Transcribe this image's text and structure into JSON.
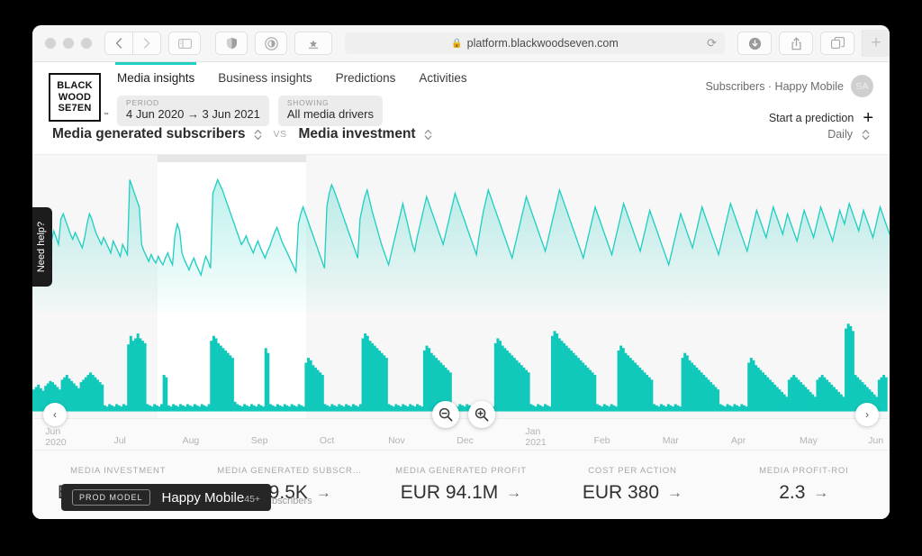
{
  "browser": {
    "url": "platform.blackwoodseven.com",
    "lock_icon": "lock-icon",
    "reload_icon": "reload-icon",
    "back_icon": "chevron-left-icon",
    "forward_icon": "chevron-right-icon",
    "sidebar_icon": "sidebar-icon",
    "shield_icon": "shield-icon",
    "reader_icon": "reader-icon",
    "bookmark_icon": "bookmark-star-icon",
    "download_icon": "download-icon",
    "share_icon": "share-icon",
    "tabs_icon": "tab-overview-icon",
    "newtab_label": "+"
  },
  "header": {
    "logo_lines": [
      "BLACK",
      "WOOD",
      "SE7EN"
    ],
    "logo_tm": "™",
    "tabs": [
      {
        "label": "Media insights",
        "active": true
      },
      {
        "label": "Business insights",
        "active": false
      },
      {
        "label": "Predictions",
        "active": false
      },
      {
        "label": "Activities",
        "active": false
      }
    ],
    "pills": [
      {
        "caption": "PERIOD",
        "value": "4 Jun 2020 → 3 Jun 2021"
      },
      {
        "caption": "SHOWING",
        "value": "All media drivers"
      }
    ],
    "account": "Subscribers · Happy Mobile",
    "avatar_initials": "SA",
    "start_prediction": "Start a prediction",
    "start_prediction_plus": "+"
  },
  "selector": {
    "primary_metric": "Media generated subscribers",
    "vs": "VS",
    "secondary_metric": "Media investment",
    "granularity": "Daily"
  },
  "chart": {
    "need_help": "Need help?",
    "prev_label": "‹",
    "next_label": "›",
    "zoom_out_icon": "zoom-out-icon",
    "zoom_in_icon": "zoom-in-icon",
    "line_color": "#21cfc2",
    "bar_color": "#11c9bb",
    "background": "#f7f7f7",
    "selection_background": "#ffffff"
  },
  "chart_data": {
    "type": "area",
    "title": "Media generated subscribers vs Media investment",
    "xlabel": "",
    "ylabel": "",
    "grid": false,
    "legend": "none",
    "x_tick_labels": [
      "Jun\n2020",
      "Jul",
      "Aug",
      "Sep",
      "Oct",
      "Nov",
      "Dec",
      "Jan\n2021",
      "Feb",
      "Mar",
      "Apr",
      "May",
      "Jun"
    ],
    "selection_range": [
      "Aug",
      "Sep"
    ],
    "series": [
      {
        "name": "Media generated subscribers",
        "type": "area",
        "color": "#21cfc2",
        "values": [
          41,
          38,
          44,
          40,
          46,
          43,
          39,
          45,
          42,
          48,
          44,
          40,
          55,
          58,
          54,
          50,
          46,
          43,
          47,
          44,
          41,
          38,
          44,
          52,
          58,
          55,
          50,
          46,
          43,
          40,
          44,
          41,
          38,
          35,
          42,
          39,
          36,
          33,
          40,
          37,
          34,
          78,
          74,
          70,
          66,
          62,
          40,
          36,
          33,
          30,
          34,
          31,
          29,
          33,
          30,
          28,
          32,
          35,
          31,
          28,
          45,
          52,
          48,
          35,
          31,
          28,
          25,
          29,
          32,
          28,
          25,
          22,
          28,
          33,
          30,
          26,
          70,
          74,
          78,
          75,
          72,
          68,
          64,
          60,
          56,
          52,
          48,
          44,
          40,
          42,
          45,
          41,
          38,
          35,
          39,
          42,
          38,
          35,
          32,
          36,
          39,
          43,
          47,
          50,
          46,
          42,
          39,
          36,
          33,
          30,
          27,
          24,
          52,
          58,
          62,
          58,
          54,
          50,
          46,
          42,
          38,
          34,
          30,
          26,
          62,
          70,
          75,
          72,
          68,
          64,
          60,
          56,
          52,
          48,
          44,
          40,
          36,
          32,
          55,
          62,
          68,
          72,
          66,
          60,
          55,
          50,
          45,
          40,
          36,
          32,
          28,
          34,
          40,
          46,
          52,
          58,
          64,
          58,
          52,
          46,
          40,
          36,
          44,
          50,
          56,
          62,
          68,
          64,
          60,
          56,
          52,
          48,
          44,
          40,
          46,
          52,
          58,
          64,
          70,
          66,
          62,
          58,
          54,
          50,
          46,
          42,
          38,
          34,
          44,
          52,
          60,
          66,
          72,
          68,
          64,
          60,
          56,
          52,
          48,
          44,
          40,
          36,
          32,
          38,
          44,
          50,
          56,
          62,
          68,
          64,
          60,
          56,
          52,
          48,
          44,
          40,
          36,
          42,
          48,
          54,
          60,
          66,
          72,
          68,
          64,
          60,
          56,
          52,
          48,
          44,
          40,
          36,
          32,
          38,
          44,
          50,
          56,
          62,
          58,
          54,
          50,
          46,
          42,
          38,
          34,
          40,
          46,
          52,
          58,
          64,
          60,
          56,
          52,
          48,
          44,
          40,
          36,
          42,
          48,
          54,
          60,
          56,
          52,
          48,
          44,
          40,
          36,
          32,
          28,
          34,
          40,
          46,
          52,
          58,
          54,
          50,
          46,
          42,
          38,
          44,
          50,
          56,
          62,
          58,
          54,
          50,
          46,
          42,
          38,
          34,
          40,
          46,
          52,
          58,
          64,
          60,
          56,
          52,
          48,
          44,
          40,
          36,
          42,
          48,
          54,
          60,
          56,
          52,
          48,
          44,
          50,
          56,
          62,
          58,
          54,
          50,
          46,
          52,
          58,
          54,
          50,
          46,
          42,
          48,
          54,
          60,
          56,
          52,
          48,
          44,
          50,
          56,
          62,
          58,
          54,
          50,
          46,
          42,
          48,
          54,
          60,
          56,
          52,
          58,
          64,
          60,
          56,
          52,
          48,
          54,
          60,
          56,
          52,
          48,
          44,
          50,
          56,
          62,
          58,
          54,
          50,
          46
        ]
      },
      {
        "name": "Media investment",
        "type": "bar",
        "color": "#11c9bb",
        "values": [
          18,
          20,
          22,
          19,
          17,
          21,
          23,
          25,
          24,
          22,
          20,
          18,
          26,
          28,
          30,
          27,
          25,
          23,
          21,
          19,
          24,
          26,
          28,
          30,
          32,
          30,
          28,
          26,
          24,
          22,
          5,
          4,
          6,
          5,
          4,
          6,
          5,
          4,
          6,
          5,
          55,
          62,
          58,
          60,
          64,
          60,
          58,
          56,
          6,
          5,
          4,
          6,
          5,
          4,
          6,
          30,
          28,
          5,
          4,
          6,
          5,
          4,
          6,
          5,
          4,
          6,
          5,
          4,
          6,
          5,
          4,
          6,
          5,
          4,
          6,
          58,
          62,
          60,
          56,
          54,
          52,
          50,
          48,
          46,
          44,
          8,
          6,
          5,
          4,
          6,
          5,
          4,
          6,
          5,
          4,
          6,
          5,
          4,
          52,
          48,
          6,
          5,
          4,
          6,
          5,
          4,
          6,
          5,
          4,
          6,
          5,
          4,
          6,
          5,
          4,
          40,
          44,
          42,
          38,
          36,
          34,
          32,
          30,
          6,
          5,
          4,
          6,
          5,
          4,
          6,
          5,
          4,
          6,
          5,
          4,
          6,
          5,
          4,
          6,
          60,
          64,
          62,
          58,
          56,
          54,
          52,
          50,
          48,
          46,
          44,
          6,
          5,
          4,
          6,
          5,
          4,
          6,
          5,
          4,
          6,
          5,
          4,
          6,
          5,
          4,
          50,
          54,
          52,
          48,
          46,
          44,
          42,
          40,
          38,
          36,
          34,
          32,
          6,
          5,
          4,
          6,
          5,
          4,
          6,
          5,
          4,
          6,
          5,
          4,
          6,
          5,
          4,
          6,
          5,
          4,
          56,
          60,
          58,
          54,
          52,
          50,
          48,
          46,
          44,
          42,
          40,
          38,
          36,
          34,
          32,
          6,
          5,
          4,
          6,
          5,
          4,
          6,
          5,
          4,
          62,
          66,
          64,
          60,
          58,
          56,
          54,
          52,
          50,
          48,
          46,
          44,
          42,
          40,
          38,
          36,
          34,
          32,
          30,
          6,
          5,
          4,
          6,
          5,
          4,
          6,
          5,
          4,
          50,
          54,
          52,
          48,
          46,
          44,
          42,
          40,
          38,
          36,
          34,
          32,
          30,
          28,
          26,
          6,
          5,
          4,
          6,
          5,
          4,
          6,
          5,
          4,
          6,
          5,
          4,
          44,
          48,
          46,
          42,
          40,
          38,
          36,
          34,
          32,
          30,
          28,
          26,
          24,
          22,
          20,
          18,
          6,
          5,
          4,
          6,
          5,
          4,
          6,
          5,
          4,
          6,
          5,
          4,
          40,
          44,
          42,
          38,
          36,
          34,
          32,
          30,
          28,
          26,
          24,
          22,
          20,
          18,
          16,
          14,
          12,
          26,
          28,
          30,
          28,
          26,
          24,
          22,
          20,
          18,
          16,
          14,
          12,
          26,
          28,
          30,
          28,
          26,
          24,
          22,
          20,
          18,
          16,
          14,
          12,
          68,
          72,
          70,
          66,
          30,
          28,
          26,
          24,
          22,
          20,
          18,
          16,
          14,
          12,
          26,
          28,
          30,
          28
        ]
      }
    ]
  },
  "kpis": [
    {
      "label": "MEDIA INVESTMENT",
      "value": "EUR 41.6M",
      "arrow": "→"
    },
    {
      "label": "MEDIA GENERATED SUBSCR…",
      "value": "109.5K",
      "arrow": "→"
    },
    {
      "label": "MEDIA GENERATED PROFIT",
      "value": "EUR 94.1M",
      "arrow": "→"
    },
    {
      "label": "COST PER ACTION",
      "value": "EUR 380",
      "arrow": "→"
    },
    {
      "label": "MEDIA PROFIT-ROI",
      "value": "2.3",
      "arrow": "→"
    }
  ],
  "footer": {
    "note": "out of total subscribers",
    "prod_tag": "PROD MODEL",
    "prod_name": "Happy Mobile",
    "prod_sub": "45+"
  }
}
